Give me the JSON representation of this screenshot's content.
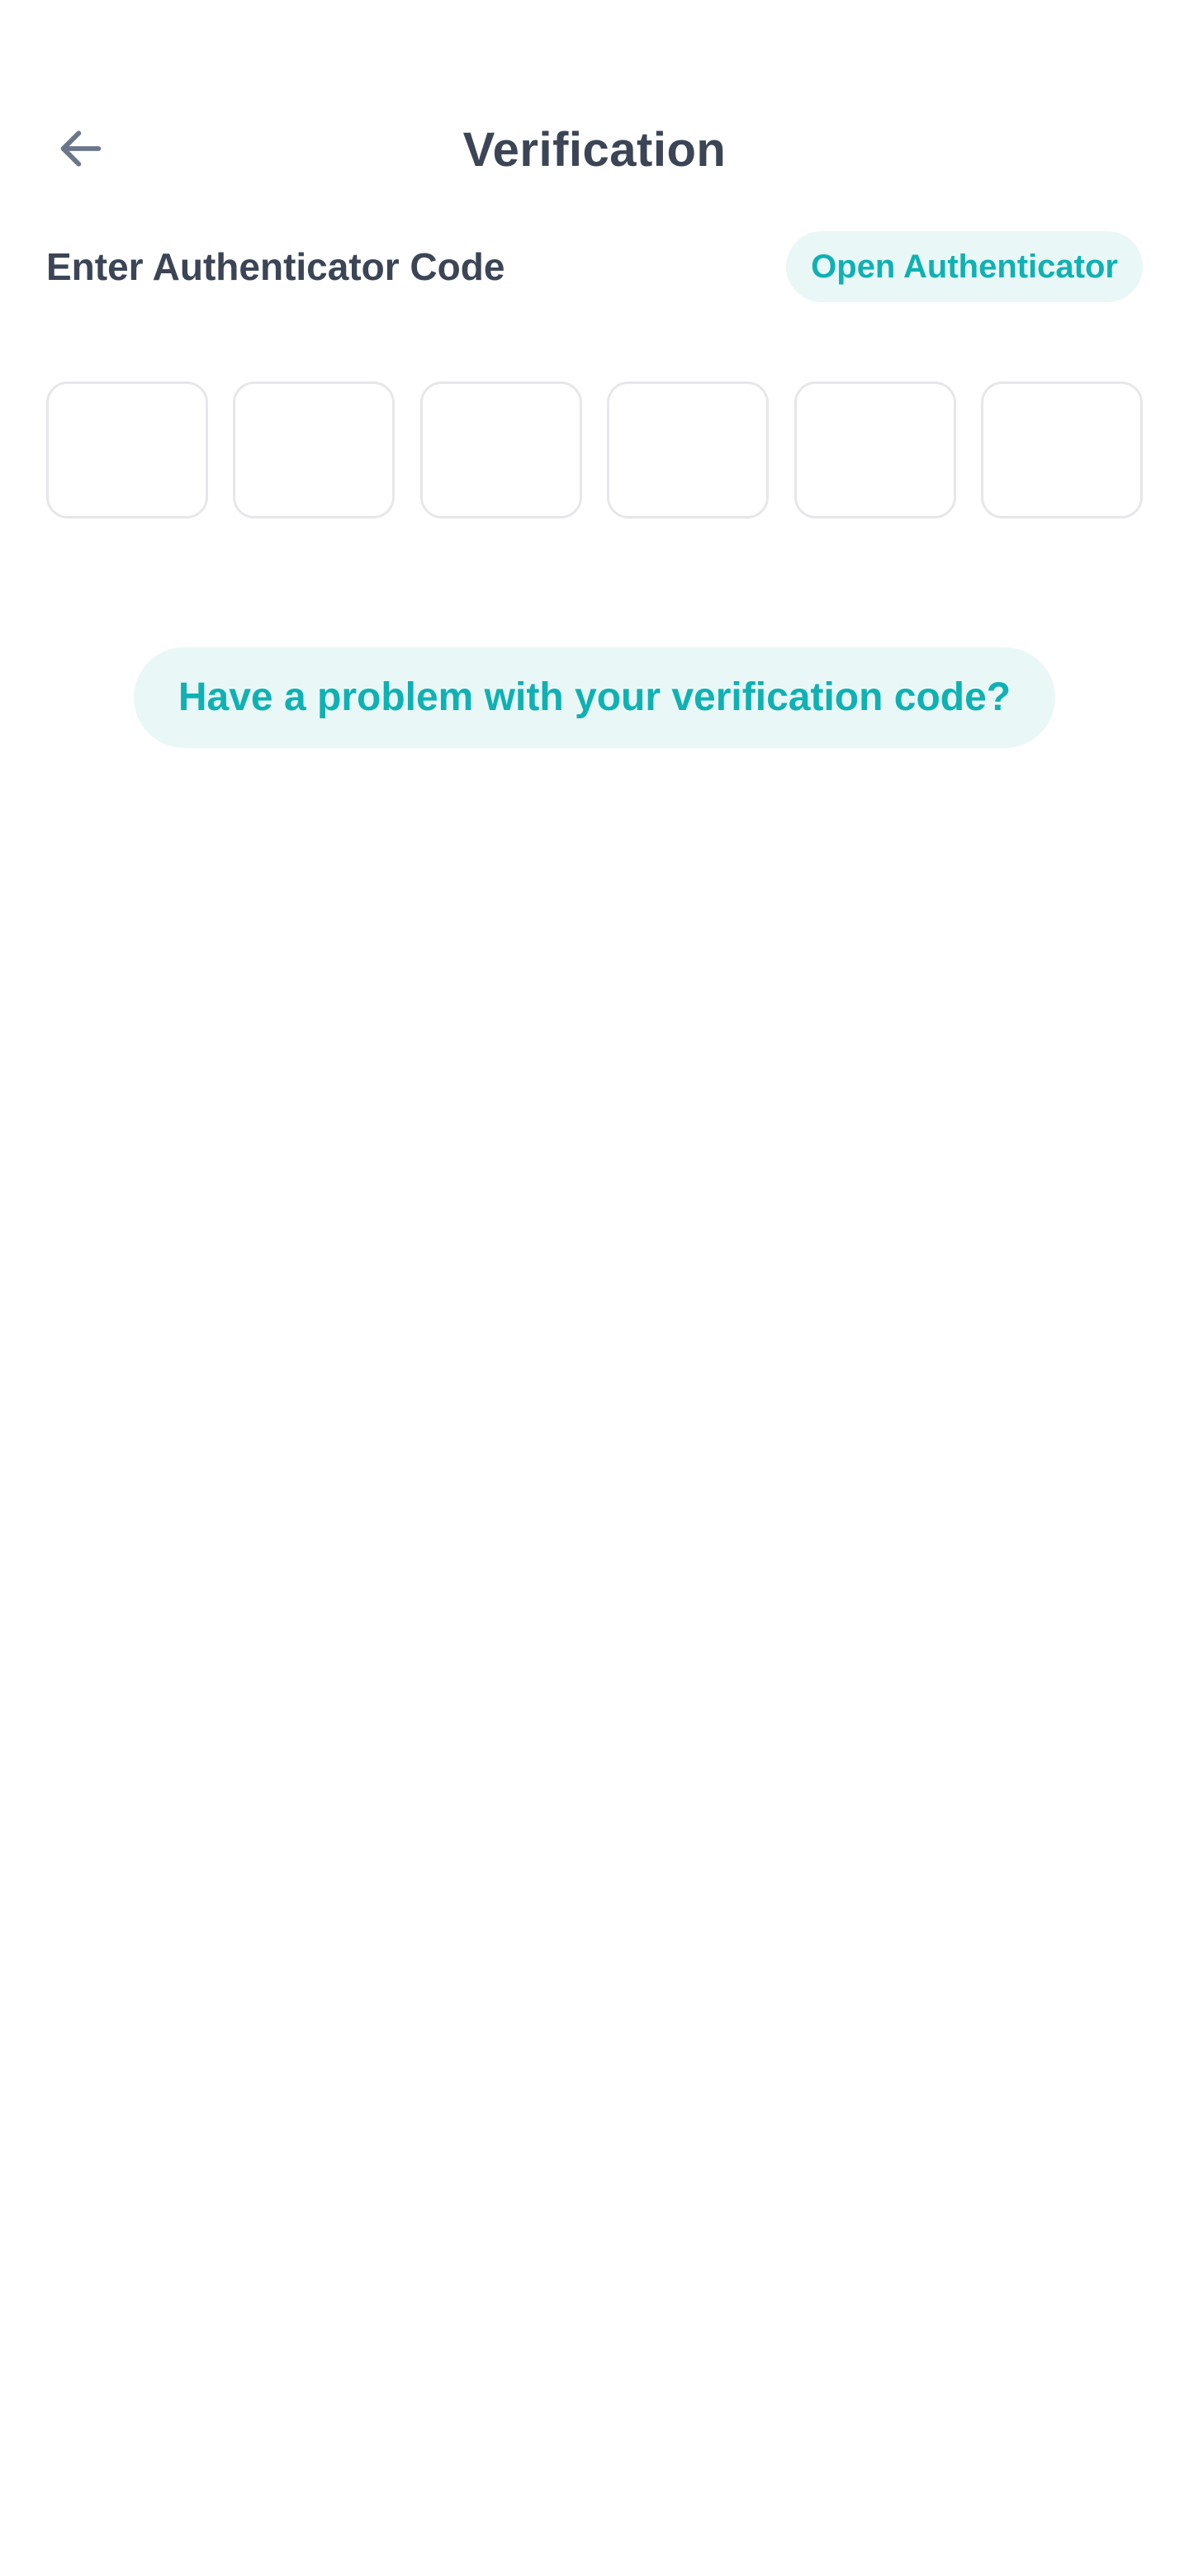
{
  "header": {
    "title": "Verification",
    "back_icon": "arrow-left-icon"
  },
  "code_section": {
    "label": "Enter Authenticator Code",
    "open_authenticator_label": "Open Authenticator",
    "digits": [
      "",
      "",
      "",
      "",
      "",
      ""
    ]
  },
  "help": {
    "label": "Have a problem with your verification code?"
  },
  "colors": {
    "text_primary": "#3b4556",
    "icon_gray": "#6b7789",
    "accent": "#0fb1b3",
    "accent_bg": "#e9f8f7",
    "input_border": "#e6e7ea"
  }
}
